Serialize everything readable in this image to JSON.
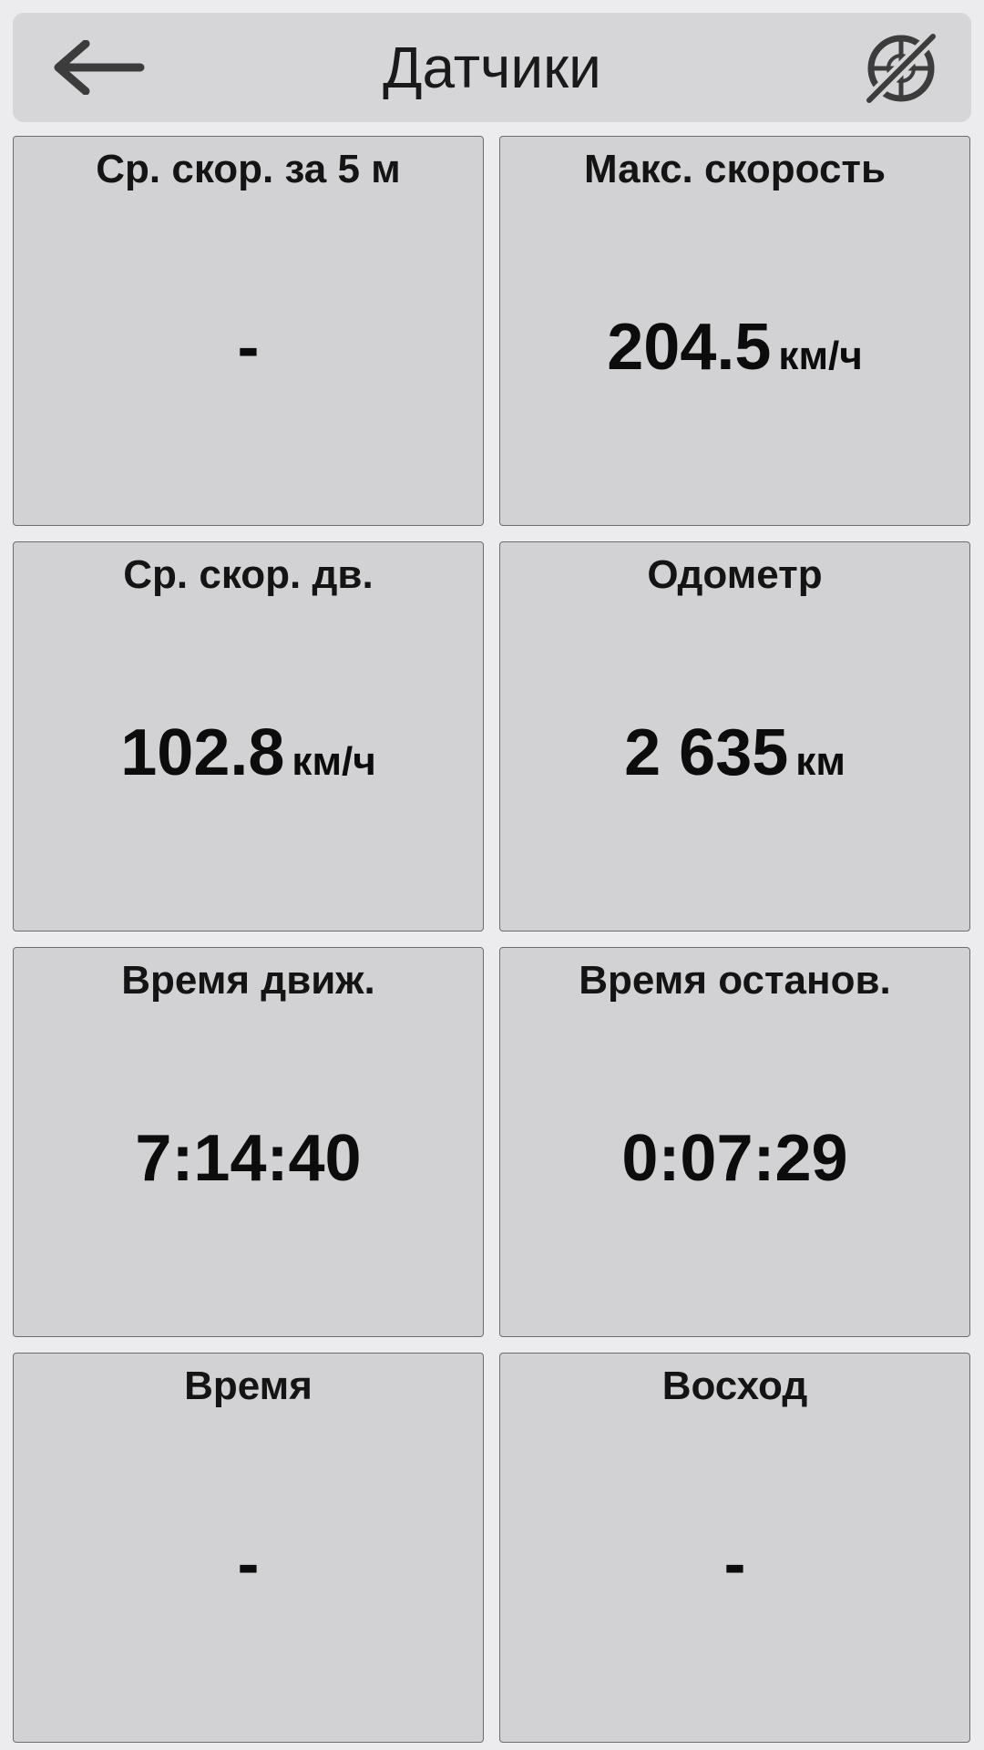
{
  "header": {
    "title": "Датчики",
    "back_icon": "arrow-left-icon",
    "gps_icon": "gps-off-icon"
  },
  "tiles": [
    {
      "label": "Ср. скор. за 5 м",
      "value": "-",
      "unit": ""
    },
    {
      "label": "Макс. скорость",
      "value": "204.5",
      "unit": "км/ч"
    },
    {
      "label": "Ср. скор. дв.",
      "value": "102.8",
      "unit": "км/ч"
    },
    {
      "label": "Одометр",
      "value": "2 635",
      "unit": "км"
    },
    {
      "label": "Время движ.",
      "value": "7:14:40",
      "unit": ""
    },
    {
      "label": "Время останов.",
      "value": "0:07:29",
      "unit": ""
    },
    {
      "label": "Время",
      "value": "-",
      "unit": ""
    },
    {
      "label": "Восход",
      "value": "-",
      "unit": ""
    }
  ],
  "colors": {
    "background": "#ececee",
    "header_bg": "#d6d6d9",
    "tile_bg": "#d2d2d5",
    "tile_border": "#6d6d70",
    "text": "#111111"
  }
}
